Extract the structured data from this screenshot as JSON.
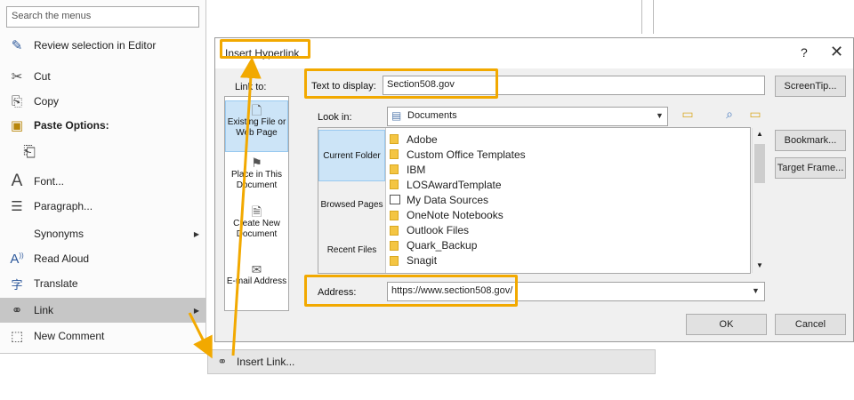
{
  "context_menu": {
    "search_placeholder": "Search the menus",
    "items": [
      {
        "icon": "edit-pen-icon",
        "glyph": "✎",
        "label": "Review selection in Editor"
      },
      {
        "icon": "scissors-icon",
        "glyph": "✂",
        "label": "Cut"
      },
      {
        "icon": "copy-icon",
        "glyph": "⎘",
        "label": "Copy"
      },
      {
        "icon": "paste-options-icon",
        "glyph": "📋",
        "label": "Paste Options:"
      },
      {
        "icon": "paste-keep-text-icon",
        "glyph": "📄",
        "label": ""
      },
      {
        "icon": "font-icon",
        "glyph": "A",
        "label": "Font..."
      },
      {
        "icon": "paragraph-icon",
        "glyph": "☰",
        "label": "Paragraph..."
      },
      {
        "icon": "",
        "glyph": "",
        "label": "Synonyms"
      },
      {
        "icon": "read-aloud-icon",
        "glyph": "A",
        "label": "Read Aloud"
      },
      {
        "icon": "translate-icon",
        "glyph": "字",
        "label": "Translate"
      },
      {
        "icon": "link-icon",
        "glyph": "🔗",
        "label": "Link"
      },
      {
        "icon": "new-comment-icon",
        "glyph": "💬",
        "label": "New Comment"
      }
    ]
  },
  "submenu": {
    "label": "Insert Link..."
  },
  "dialog": {
    "title": "Insert Hyperlink",
    "help": "?",
    "close": "✕",
    "link_to_label": "Link to:",
    "text_to_display_label": "Text to display:",
    "text_to_display_value": "Section508.gov",
    "look_in_label": "Look in:",
    "look_in_value": "Documents",
    "address_label": "Address:",
    "address_value": "https://www.section508.gov/",
    "link_to_options": [
      {
        "label": "Existing File or Web Page"
      },
      {
        "label": "Place in This Document"
      },
      {
        "label": "Create New Document"
      },
      {
        "label": "E-mail Address"
      }
    ],
    "nav": [
      {
        "label": "Current Folder"
      },
      {
        "label": "Browsed Pages"
      },
      {
        "label": "Recent Files"
      }
    ],
    "files": [
      "Adobe",
      "Custom Office Templates",
      "IBM",
      "LOSAwardTemplate",
      "My Data Sources",
      "OneNote Notebooks",
      "Outlook Files",
      "Quark_Backup",
      "Snagit"
    ],
    "buttons": {
      "screentip": "ScreenTip...",
      "bookmark": "Bookmark...",
      "target_frame": "Target Frame...",
      "ok": "OK",
      "cancel": "Cancel"
    }
  },
  "colors": {
    "highlight": "#f2a900",
    "selected": "#cce4f7",
    "menu_hover": "#c6c6c6"
  }
}
